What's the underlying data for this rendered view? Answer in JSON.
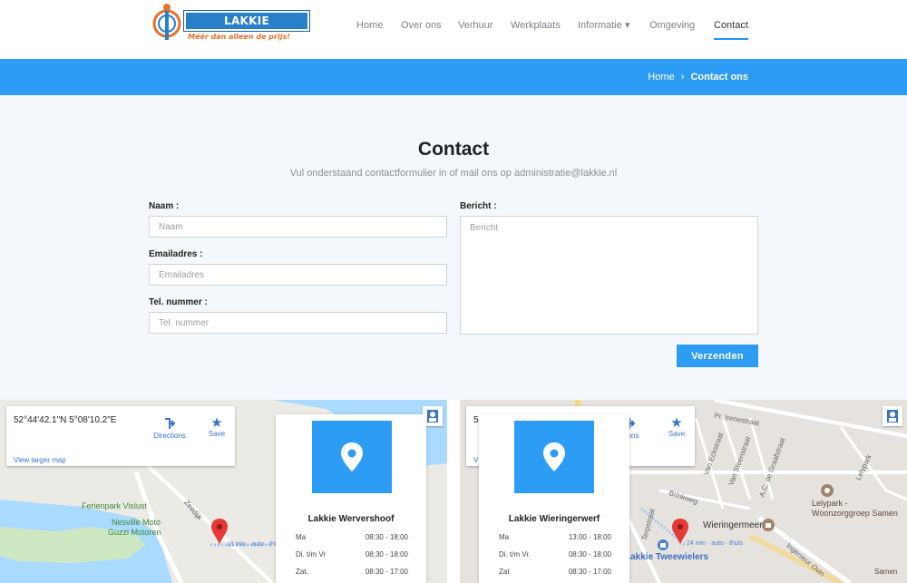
{
  "brand": {
    "name": "LAKKIE TWEEWIELERS",
    "tagline": "Méér dan alleen de prijs!"
  },
  "nav": {
    "items": [
      "Home",
      "Over ons",
      "Verhuur",
      "Werkplaats",
      "Informatie ▾",
      "Omgeving",
      "Contact"
    ],
    "active": "Contact"
  },
  "breadcrumb": {
    "home": "Home",
    "sep": "›",
    "current": "Contact ons"
  },
  "contact": {
    "title": "Contact",
    "subtitle": "Vul onderstaand contactformulier in of mail ons op administratie@lakkie.nl",
    "name_label": "Naam :",
    "name_placeholder": "Naam",
    "email_label": "Emailadres :",
    "email_placeholder": "Emailadres",
    "phone_label": "Tel. nummer :",
    "phone_placeholder": "Tel. nummer",
    "message_label": "Bericht :",
    "message_placeholder": "Bericht",
    "submit": "Verzenden"
  },
  "map_left": {
    "coords": "52°44'42.1\"N 5°08'10.2\"E",
    "directions": "Directions",
    "save": "Save",
    "larger": "View larger map",
    "labels": {
      "park": "Ferienpark Vislust",
      "dealer1": "Nesville Moto",
      "dealer2": "Guzzi Motoren",
      "road": "Zeedijk",
      "route": "16 min · auto · thuis"
    },
    "location": {
      "name": "Lakkie Wervershoof",
      "hours": [
        {
          "day": "Ma",
          "time": "08:30 - 18:00"
        },
        {
          "day": "Di. t/m Vr",
          "time": "08:30 - 18:00"
        },
        {
          "day": "Zat.",
          "time": "08:30 - 17:00"
        }
      ]
    }
  },
  "map_right": {
    "coords": "52",
    "directions": "ctions",
    "save": "Save",
    "larger": "V",
    "labels": {
      "street1": "Pr. Irenestraat",
      "street2": "Van Eckstraat",
      "street3": "Van Steenstraat",
      "street4": "A.C. de Graafstraat",
      "street5": "Brinkweg",
      "street6": "Terpstraat",
      "place": "Wieringermeer",
      "park1": "Lelypark -",
      "park2": "Woonzorggroep Samen",
      "shop": "Lakkie Tweewielers",
      "route": "24 min · auto · thuis",
      "lelypark": "Lelypark",
      "ingenieur": "Ingenieur Ovin",
      "samen": "Samen"
    },
    "location": {
      "name": "Lakkie Wieringerwerf",
      "hours": [
        {
          "day": "Ma",
          "time": "13:00 - 18:00"
        },
        {
          "day": "Di. t/m Vr.",
          "time": "08:30 - 18:00"
        },
        {
          "day": "Zat",
          "time": "08:30 - 17:00"
        }
      ]
    }
  },
  "colors": {
    "accent": "#2d9cf4",
    "pin": "#e53935",
    "water": "#aadaff"
  }
}
